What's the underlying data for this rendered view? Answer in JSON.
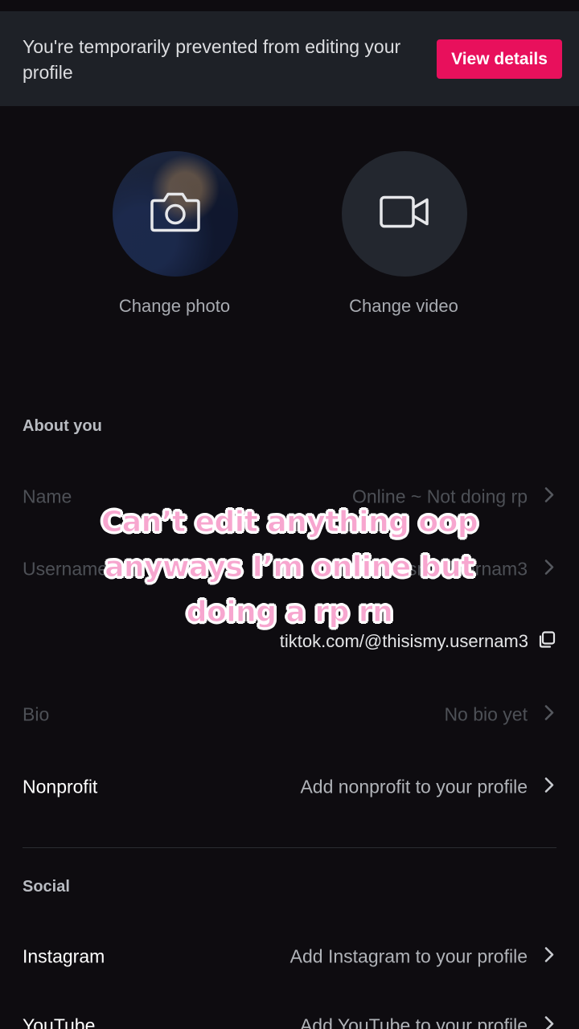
{
  "banner": {
    "text": "You're temporarily prevented from editing your profile",
    "button_label": "View details"
  },
  "media": {
    "photo_label": "Change photo",
    "video_label": "Change video"
  },
  "about": {
    "title": "About you",
    "name_label": "Name",
    "name_value": "Online ~ Not doing rp",
    "username_label": "Username",
    "username_value": "thisismy.usernam3",
    "profile_link": "tiktok.com/@thisismy.usernam3",
    "bio_label": "Bio",
    "bio_value": "No bio yet",
    "nonprofit_label": "Nonprofit",
    "nonprofit_value": "Add nonprofit to your profile"
  },
  "social": {
    "title": "Social",
    "instagram_label": "Instagram",
    "instagram_value": "Add Instagram to your profile",
    "youtube_label": "YouTube",
    "youtube_value": "Add YouTube to your profile"
  },
  "overlay_caption": {
    "line1": "Can’t edit anything oop",
    "line2": "anyways I’m online but",
    "line3": "doing a rp rn"
  },
  "colors": {
    "background": "#0e0c10",
    "banner_bg": "#1e2127",
    "accent": "#e8105c",
    "caption_fill": "#f7a6cf"
  }
}
